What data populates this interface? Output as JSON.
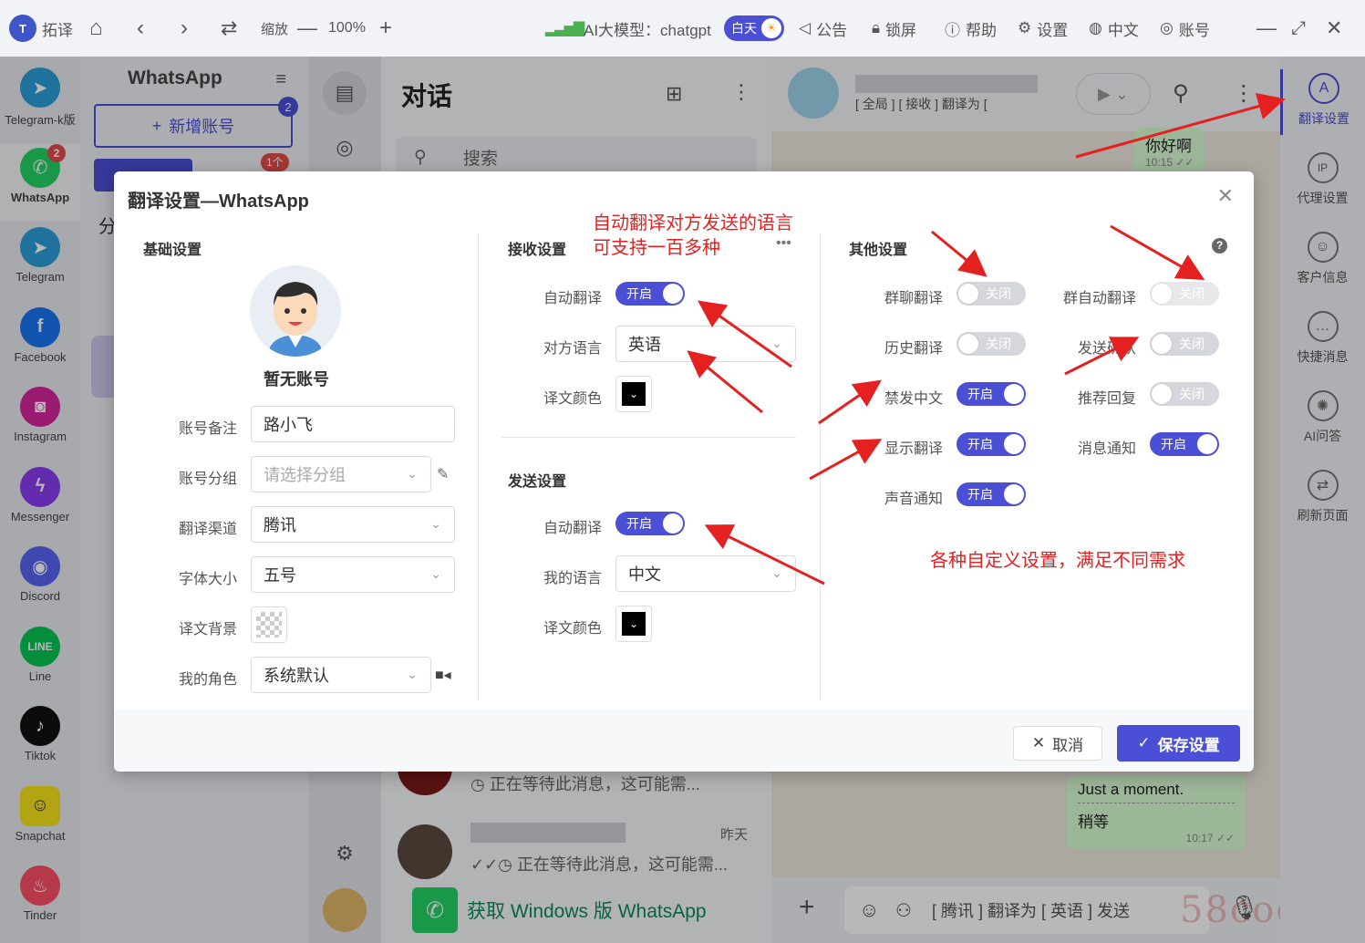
{
  "topbar": {
    "app_name": "拓译",
    "zoom_label": "缩放",
    "zoom_value": "100%",
    "ai_model_label": "AI大模型：chatgpt",
    "theme_label": "白天",
    "announcement": "公告",
    "lock": "锁屏",
    "help": "帮助",
    "settings": "设置",
    "language": "中文",
    "account": "账号"
  },
  "apps": [
    {
      "label": "Telegram-k版",
      "icon": "telegram-icon",
      "color": "#2a9fd8"
    },
    {
      "label": "WhatsApp",
      "icon": "whatsapp-icon",
      "color": "#25d366",
      "badge": "2"
    },
    {
      "label": "Telegram",
      "icon": "telegram-icon",
      "color": "#2a9fd8"
    },
    {
      "label": "Facebook",
      "icon": "facebook-icon",
      "color": "#1877f2"
    },
    {
      "label": "Instagram",
      "icon": "instagram-icon",
      "color": "#d6249f"
    },
    {
      "label": "Messenger",
      "icon": "messenger-icon",
      "color": "#8a3cf0"
    },
    {
      "label": "Discord",
      "icon": "discord-icon",
      "color": "#5865f2"
    },
    {
      "label": "Line",
      "icon": "line-icon",
      "color": "#06c755"
    },
    {
      "label": "Tiktok",
      "icon": "tiktok-icon",
      "color": "#111111"
    },
    {
      "label": "Snapchat",
      "icon": "snapchat-icon",
      "color": "#f7e31a"
    },
    {
      "label": "Tinder",
      "icon": "tinder-icon",
      "color": "#fd5068"
    }
  ],
  "account_panel": {
    "title": "WhatsApp",
    "add_label": "新增账号",
    "add_badge": "2",
    "tab_badge": "1个",
    "group_initial": "分"
  },
  "chats": {
    "title": "对话",
    "search_placeholder": "搜索",
    "rows": [
      {
        "message": "正在等待此消息，这可能需...",
        "time": ""
      },
      {
        "message": "正在等待此消息，这可能需...",
        "time": "昨天"
      }
    ],
    "get_whatsapp": "获取 Windows 版 WhatsApp"
  },
  "conversation": {
    "subtitle": "[ 全局 ] [ 接收 ]  翻译为 [",
    "messages": [
      {
        "text": "你好啊",
        "time": "10:15"
      },
      {
        "text": "Just a moment.",
        "translation": "稍等",
        "time": "10:17"
      }
    ],
    "input_hint": "[ 腾讯 ] 翻译为 [ 英语 ] 发送"
  },
  "right_rail": [
    {
      "label": "翻译设置",
      "icon": "translate-icon",
      "active": true
    },
    {
      "label": "代理设置",
      "icon": "proxy-icon"
    },
    {
      "label": "客户信息",
      "icon": "customer-icon"
    },
    {
      "label": "快捷消息",
      "icon": "quick-message-icon"
    },
    {
      "label": "AI问答",
      "icon": "ai-icon"
    },
    {
      "label": "刷新页面",
      "icon": "refresh-icon"
    }
  ],
  "modal": {
    "title": "翻译设置—WhatsApp",
    "basic": {
      "section_title": "基础设置",
      "no_account": "暂无账号",
      "remark_label": "账号备注",
      "remark_value": "路小飞",
      "group_label": "账号分组",
      "group_placeholder": "请选择分组",
      "channel_label": "翻译渠道",
      "channel_value": "腾讯",
      "font_label": "字体大小",
      "font_value": "五号",
      "bg_label": "译文背景",
      "role_label": "我的角色",
      "role_value": "系统默认"
    },
    "receive": {
      "section_title": "接收设置",
      "auto_label": "自动翻译",
      "auto_state": "开启",
      "lang_label": "对方语言",
      "lang_value": "英语",
      "color_label": "译文颜色"
    },
    "send": {
      "section_title": "发送设置",
      "auto_label": "自动翻译",
      "auto_state": "开启",
      "lang_label": "我的语言",
      "lang_value": "中文",
      "color_label": "译文颜色"
    },
    "other": {
      "section_title": "其他设置",
      "group_chat": {
        "label": "群聊翻译",
        "state": "关闭"
      },
      "group_auto": {
        "label": "群自动翻译",
        "state": "关闭"
      },
      "history": {
        "label": "历史翻译",
        "state": "关闭"
      },
      "send_confirm": {
        "label": "发送确认",
        "state": "关闭"
      },
      "ban_chinese": {
        "label": "禁发中文",
        "state": "开启"
      },
      "recommend": {
        "label": "推荐回复",
        "state": "关闭"
      },
      "show_trans": {
        "label": "显示翻译",
        "state": "开启"
      },
      "msg_notify": {
        "label": "消息通知",
        "state": "开启"
      },
      "sound_notify": {
        "label": "声音通知",
        "state": "开启"
      }
    },
    "cancel": "取消",
    "save": "保存设置"
  },
  "annotations": {
    "auto_lang_line1": "自动翻译对方发送的语言",
    "auto_lang_line2": "可支持一百多种",
    "custom": "各种自定义设置，满足不同需求"
  },
  "watermark": "58codes",
  "colors": {
    "accent": "#4a4fd6",
    "annotation": "#e52020",
    "off": "#d6d7dc"
  }
}
